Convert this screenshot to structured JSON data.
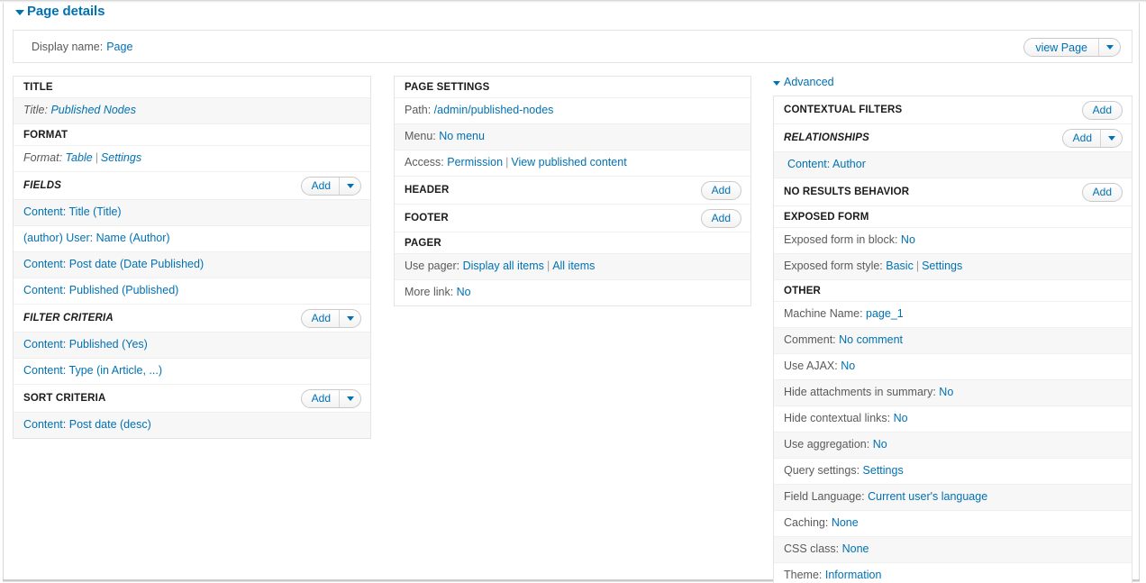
{
  "header": {
    "title": "Page details",
    "twisty_icon": "caret-down-icon"
  },
  "display_name": {
    "label": "Display name:",
    "value": "Page"
  },
  "view_button": {
    "label": "view Page",
    "arrow_icon": "caret-down-icon"
  },
  "buttons": {
    "add_label": "Add",
    "arrow_icon": "caret-down-icon"
  },
  "column1": {
    "sections": [
      {
        "title": "TITLE",
        "has_add": false,
        "rows": [
          {
            "label": "Title:",
            "links": [
              "Published Nodes"
            ],
            "italic": true,
            "alt": true
          }
        ]
      },
      {
        "title": "FORMAT",
        "has_add": false,
        "rows": [
          {
            "label": "Format:",
            "links": [
              "Table",
              "Settings"
            ],
            "italic": true,
            "alt": false
          }
        ]
      },
      {
        "title": "FIELDS",
        "title_italic": true,
        "has_add": true,
        "add_split": true,
        "rows": [
          {
            "label": "",
            "links": [
              "Content: Title (Title)"
            ],
            "alt": true
          },
          {
            "label": "",
            "links": [
              "(author) User: Name (Author)"
            ],
            "alt": false
          },
          {
            "label": "",
            "links": [
              "Content: Post date (Date Published)"
            ],
            "alt": true
          },
          {
            "label": "",
            "links": [
              "Content: Published (Published)"
            ],
            "alt": false
          }
        ]
      },
      {
        "title": "FILTER CRITERIA",
        "title_italic": true,
        "has_add": true,
        "add_split": true,
        "rows": [
          {
            "label": "",
            "links": [
              "Content: Published (Yes)"
            ],
            "alt": true
          },
          {
            "label": "",
            "links": [
              "Content: Type (in Article, ...)"
            ],
            "alt": false
          }
        ]
      },
      {
        "title": "SORT CRITERIA",
        "title_italic": false,
        "has_add": true,
        "add_split": true,
        "rows": [
          {
            "label": "",
            "links": [
              "Content: Post date (desc)"
            ],
            "alt": true
          }
        ]
      }
    ]
  },
  "column2": {
    "sections": [
      {
        "title": "PAGE SETTINGS",
        "has_add": false,
        "rows": [
          {
            "label": "Path:",
            "links": [
              "/admin/published-nodes"
            ],
            "alt": false
          },
          {
            "label": "Menu:",
            "links": [
              "No menu"
            ],
            "alt": true
          },
          {
            "label": "Access:",
            "links": [
              "Permission",
              "View published content"
            ],
            "alt": false
          }
        ]
      },
      {
        "title": "HEADER",
        "has_add": true,
        "add_split": false,
        "rows": []
      },
      {
        "title": "FOOTER",
        "has_add": true,
        "add_split": false,
        "rows": []
      },
      {
        "title": "PAGER",
        "has_add": false,
        "rows": [
          {
            "label": "Use pager:",
            "links": [
              "Display all items",
              "All items"
            ],
            "alt": true
          },
          {
            "label": "More link:",
            "links": [
              "No"
            ],
            "alt": false
          }
        ]
      }
    ]
  },
  "column3": {
    "advanced_label": "Advanced",
    "sections": [
      {
        "title": "CONTEXTUAL FILTERS",
        "has_add": true,
        "add_split": false,
        "rows": []
      },
      {
        "title": "RELATIONSHIPS",
        "title_italic": true,
        "has_add": true,
        "add_split": true,
        "rows": [
          {
            "label": "",
            "links": [
              "Content: Author"
            ],
            "alt": true,
            "indent": true
          }
        ]
      },
      {
        "title": "NO RESULTS BEHAVIOR",
        "has_add": true,
        "add_split": false,
        "rows": []
      },
      {
        "title": "EXPOSED FORM",
        "has_add": false,
        "rows": [
          {
            "label": "Exposed form in block:",
            "links": [
              "No"
            ],
            "alt": false
          },
          {
            "label": "Exposed form style:",
            "links": [
              "Basic",
              "Settings"
            ],
            "alt": true
          }
        ]
      },
      {
        "title": "OTHER",
        "has_add": false,
        "rows": [
          {
            "label": "Machine Name:",
            "links": [
              "page_1"
            ],
            "alt": false
          },
          {
            "label": "Comment:",
            "links": [
              "No comment"
            ],
            "alt": true
          },
          {
            "label": "Use AJAX:",
            "links": [
              "No"
            ],
            "alt": false
          },
          {
            "label": "Hide attachments in summary:",
            "links": [
              "No"
            ],
            "alt": true
          },
          {
            "label": "Hide contextual links:",
            "links": [
              "No"
            ],
            "alt": false
          },
          {
            "label": "Use aggregation:",
            "links": [
              "No"
            ],
            "alt": true
          },
          {
            "label": "Query settings:",
            "links": [
              "Settings"
            ],
            "alt": false
          },
          {
            "label": "Field Language:",
            "links": [
              "Current user's language"
            ],
            "alt": true
          },
          {
            "label": "Caching:",
            "links": [
              "None"
            ],
            "alt": false
          },
          {
            "label": "CSS class:",
            "links": [
              "None"
            ],
            "alt": true
          },
          {
            "label": "Theme:",
            "links": [
              "Information"
            ],
            "alt": false
          }
        ]
      }
    ]
  },
  "colors": {
    "link": "#0071b3",
    "label": "#5a5a5a",
    "heading": "#1b1b1b",
    "row_alt": "#f7f7f7",
    "border": "#e4e4e4"
  }
}
